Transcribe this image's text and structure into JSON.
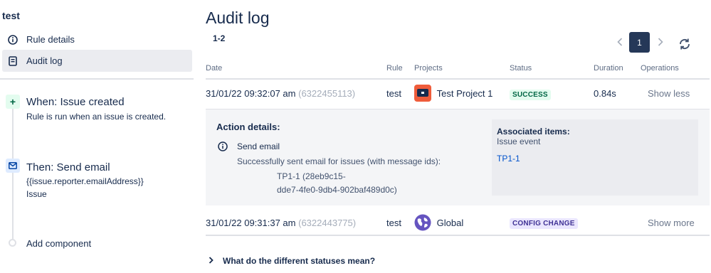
{
  "sidebar": {
    "rule_name": "test",
    "nav": [
      {
        "label": "Rule details",
        "icon": "info-icon"
      },
      {
        "label": "Audit log",
        "icon": "document-icon",
        "active": true
      }
    ],
    "trigger": {
      "badge": "+",
      "title": "When: Issue created",
      "description": "Rule is run when an issue is created."
    },
    "action": {
      "title": "Then: Send email",
      "to": "{{issue.reporter.emailAddress}}",
      "subject": "Issue"
    },
    "add_component": "Add component"
  },
  "main": {
    "title": "Audit log",
    "range": "1-2",
    "pagination": {
      "current_page": "1",
      "prev_icon": "chevron-left-icon",
      "next_icon": "chevron-right-icon"
    },
    "columns": {
      "date": "Date",
      "rule": "Rule",
      "projects": "Projects",
      "status": "Status",
      "duration": "Duration",
      "operations": "Operations"
    },
    "rows": [
      {
        "date": "31/01/22 09:32:07 am",
        "id": "(6322455113)",
        "rule": "test",
        "project": "Test Project 1",
        "status": "SUCCESS",
        "duration": "0.84s",
        "operation": "Show less"
      },
      {
        "date": "31/01/22 09:31:37 am",
        "id": "(6322443775)",
        "rule": "test",
        "project": "Global",
        "status": "CONFIG CHANGE",
        "duration": "",
        "operation": "Show more"
      }
    ],
    "details": {
      "heading": "Action details:",
      "action_name": "Send email",
      "message": "Successfully sent email for issues (with message ids):",
      "message_id_line1": "TP1-1 (28eb9c15-",
      "message_id_line2": "dde7-4fe0-9db4-902baf489d0c)",
      "associated_title": "Associated items:",
      "associated_sub": "Issue event",
      "associated_link": "TP1-1"
    },
    "faq": "What do the different statuses mean?"
  },
  "colors": {
    "success_bg": "#e3fcef",
    "success_text": "#006644",
    "config_bg": "#eae6ff",
    "config_text": "#403294",
    "pager_active": "#253858",
    "link": "#0052cc"
  }
}
